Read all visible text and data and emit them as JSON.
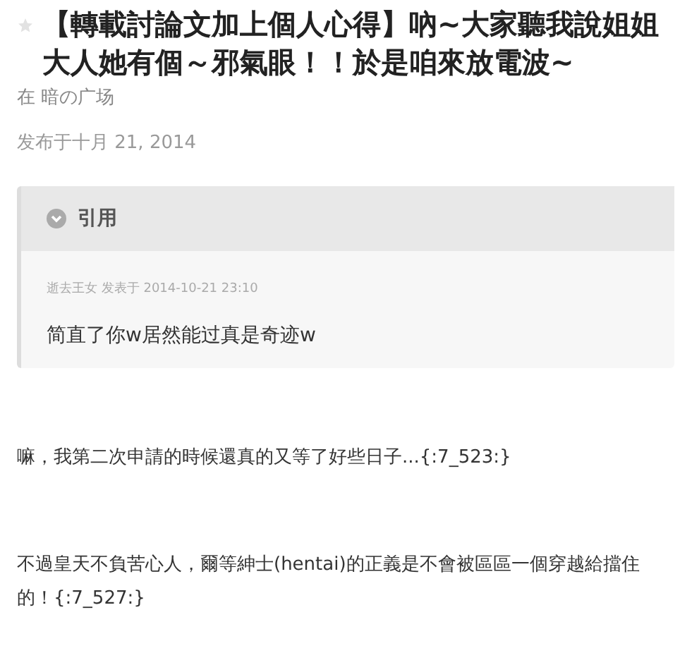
{
  "post": {
    "starred": false,
    "title": "【轉載討論文加上個人心得】吶~大家聽我說姐姐大人她有個～邪氣眼！！於是咱來放電波~",
    "forum": "在 暗の广场",
    "date": "发布于十月 21, 2014"
  },
  "quote": {
    "label": "引用",
    "expanded": true,
    "meta": "逝去王女 发表于 2014-10-21 23:10",
    "text": "简直了你w居然能过真是奇迹w"
  },
  "paragraphs": [
    "嘛，我第二次申請的時候還真的又等了好些日子...{:7_523:}",
    "不過皇天不負苦心人，爾等紳士(hentai)的正義是不會被區區一個穿越給擋住的！{:7_527:}"
  ]
}
